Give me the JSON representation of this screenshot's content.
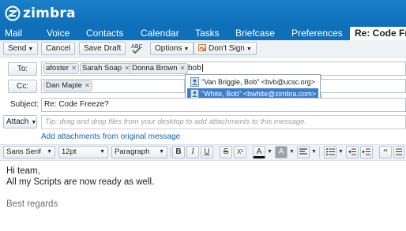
{
  "app": {
    "logo_text": "zimbra"
  },
  "nav": {
    "tabs": [
      {
        "label": "Mail"
      },
      {
        "label": "Voice"
      },
      {
        "label": "Contacts"
      },
      {
        "label": "Calendar"
      },
      {
        "label": "Tasks"
      },
      {
        "label": "Briefcase"
      },
      {
        "label": "Preferences"
      },
      {
        "label": "Re: Code Fr"
      }
    ]
  },
  "toolbar": {
    "send": "Send",
    "cancel": "Cancel",
    "save_draft": "Save Draft",
    "options": "Options",
    "dont_sign": "Don't Sign"
  },
  "compose": {
    "to_label": "To:",
    "to_recipients": [
      "afoster",
      "Sarah Soap",
      "Donna Brown"
    ],
    "to_typed": "bob",
    "cc_label": "Cc:",
    "cc_recipients": [
      "Dan Maple"
    ],
    "subject_label": "Subject:",
    "subject": "Re: Code Freeze?",
    "attach_label": "Attach",
    "attach_hint": "Tip: drag and drop files from your desktop to add attachments to this message.",
    "add_attachments_link": "Add attachments from original message"
  },
  "autocomplete": [
    {
      "text": "\"Van Briggle, Bob\" <bvb@ucsc.org>",
      "selected": false
    },
    {
      "text": "\"White, Bob\" <bwhite@zimbra.com>",
      "selected": true
    }
  ],
  "format": {
    "font": "Sans Serif",
    "size": "12pt",
    "paragraph": "Paragraph"
  },
  "body": {
    "lines": [
      "Hi team,",
      "All my Scripts are now ready as well.",
      "",
      "Best regards"
    ]
  },
  "colors": {
    "header_blue": "#1b7fc9",
    "selection_blue": "#3b7ed1",
    "link_blue": "#1a5fb4"
  }
}
